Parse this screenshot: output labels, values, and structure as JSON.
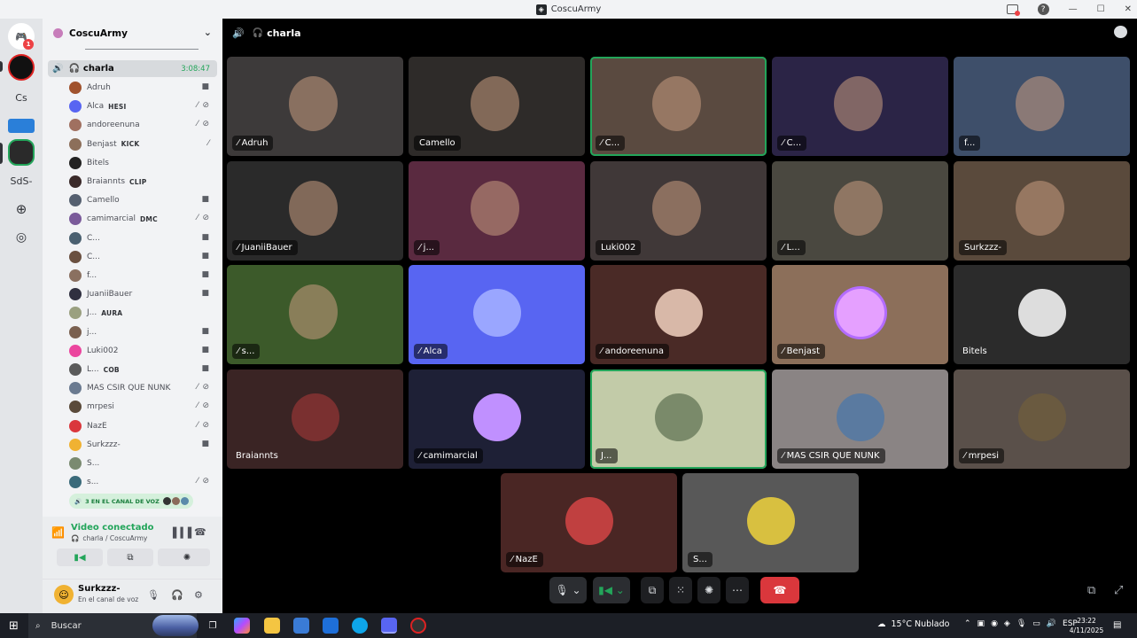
{
  "window": {
    "title": "CoscuArmy"
  },
  "rail": {
    "servers": [
      "Cs",
      "SdS-"
    ],
    "badge": "1"
  },
  "sidebar": {
    "server_name": "CoscuArmy",
    "active_channel": {
      "name": "charla",
      "timer": "3:08:47"
    },
    "members": [
      {
        "name": "Adruh",
        "tag": "",
        "color": "#a0522d"
      },
      {
        "name": "Alca",
        "tag": "HESI",
        "color": "#5865f2"
      },
      {
        "name": "andoreenuna",
        "tag": "",
        "color": "#a07060"
      },
      {
        "name": "Benjast",
        "tag": "KICK",
        "color": "#8c6f5a"
      },
      {
        "name": "Bitels",
        "tag": "",
        "color": "#222222"
      },
      {
        "name": "Braiannts",
        "tag": "CLIP",
        "color": "#3a2a2a"
      },
      {
        "name": "Camello",
        "tag": "",
        "color": "#556070"
      },
      {
        "name": "camimarcial",
        "tag": "DMC",
        "color": "#7a5a9a"
      },
      {
        "name": "C...",
        "tag": "",
        "color": "#4a6070"
      },
      {
        "name": "C...",
        "tag": "",
        "color": "#6a5040"
      },
      {
        "name": "f...",
        "tag": "",
        "color": "#8a7060"
      },
      {
        "name": "JuaniiBauer",
        "tag": "",
        "color": "#303040"
      },
      {
        "name": "J...",
        "tag": "AURA",
        "color": "#9aa080"
      },
      {
        "name": "j...",
        "tag": "",
        "color": "#7a6050"
      },
      {
        "name": "Luki002",
        "tag": "",
        "color": "#eb459e"
      },
      {
        "name": "L...",
        "tag": "COB",
        "color": "#5a5a5a"
      },
      {
        "name": "MAS CSIR QUE NUNK",
        "tag": "",
        "color": "#6a7a90"
      },
      {
        "name": "mrpesi",
        "tag": "",
        "color": "#5a4a3a"
      },
      {
        "name": "NazE",
        "tag": "",
        "color": "#da373c"
      },
      {
        "name": "Surkzzz-",
        "tag": "",
        "color": "#f0b232"
      },
      {
        "name": "S...",
        "tag": "",
        "color": "#7a8a70"
      },
      {
        "name": "s...",
        "tag": "",
        "color": "#3a6a7a"
      }
    ],
    "in_canal": "3 EN EL CANAL DE VOZ"
  },
  "voice": {
    "status": "Video conectado",
    "location": "charla / CoscuArmy"
  },
  "user": {
    "name": "Surkzzz-",
    "status": "En el canal de voz"
  },
  "main": {
    "channel": "charla",
    "tiles": [
      {
        "label": "Adruh"
      },
      {
        "label": "Camello"
      },
      {
        "label": "C..."
      },
      {
        "label": "C..."
      },
      {
        "label": "f..."
      },
      {
        "label": "JuaniiBauer"
      },
      {
        "label": "j..."
      },
      {
        "label": "Luki002"
      },
      {
        "label": "L..."
      },
      {
        "label": "Surkzzz-"
      },
      {
        "label": "s..."
      },
      {
        "label": "Alca"
      },
      {
        "label": "andoreenuna"
      },
      {
        "label": "Benjast"
      },
      {
        "label": "Bitels"
      },
      {
        "label": "Braiannts"
      },
      {
        "label": "camimarcial"
      },
      {
        "label": "J..."
      },
      {
        "label": "MAS CSIR QUE NUNK"
      },
      {
        "label": "mrpesi"
      },
      {
        "label": "NazE"
      },
      {
        "label": "S..."
      }
    ]
  },
  "taskbar": {
    "search": "Buscar",
    "weather": "15°C  Nublado",
    "lang": "ESP",
    "time": "23:22",
    "date": "4/11/2025",
    "notif_count": "6"
  }
}
